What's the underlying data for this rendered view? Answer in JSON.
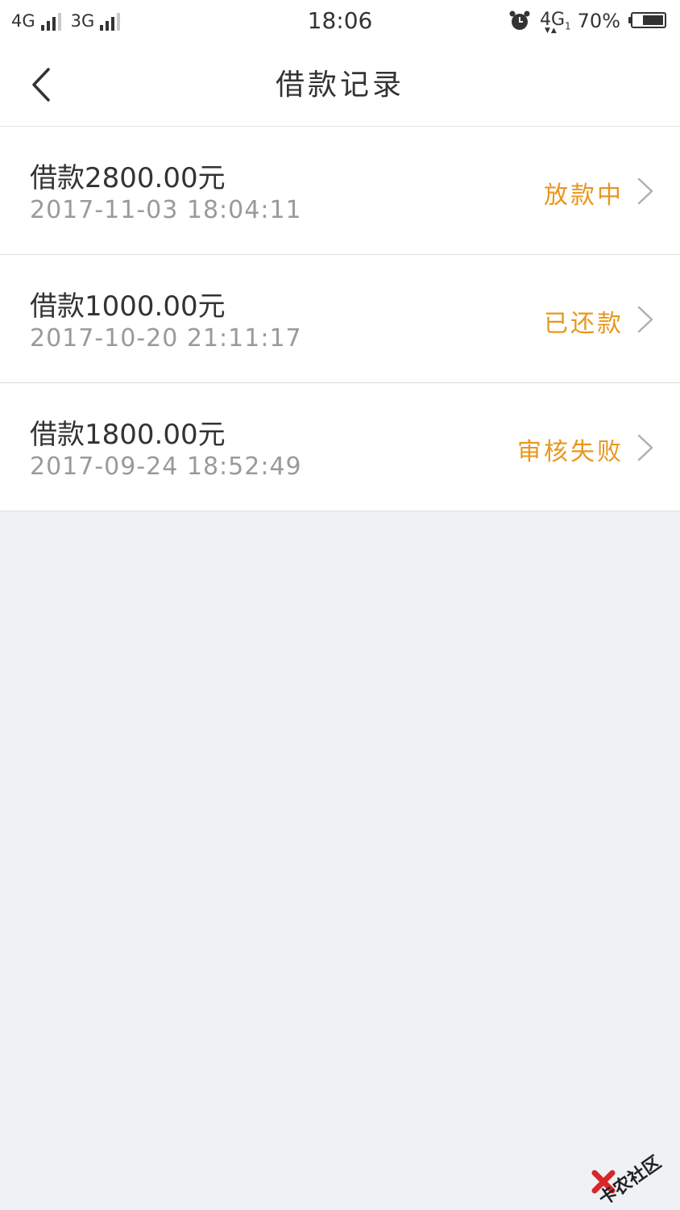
{
  "status_bar": {
    "net1": "4G",
    "net2": "3G",
    "time": "18:06",
    "net3": "4G",
    "net3_sub": "1",
    "battery": "70%",
    "battery_level": 0.7
  },
  "header": {
    "title": "借款记录"
  },
  "loans": [
    {
      "amount": "借款2800.00元",
      "time": "2017-11-03 18:04:11",
      "status": "放款中"
    },
    {
      "amount": "借款1000.00元",
      "time": "2017-10-20 21:11:17",
      "status": "已还款"
    },
    {
      "amount": "借款1800.00元",
      "time": "2017-09-24 18:52:49",
      "status": "审核失败"
    }
  ],
  "watermark": {
    "text": "卡农社区"
  },
  "colors": {
    "status_accent": "#e8971d",
    "background": "#eff2f5"
  }
}
